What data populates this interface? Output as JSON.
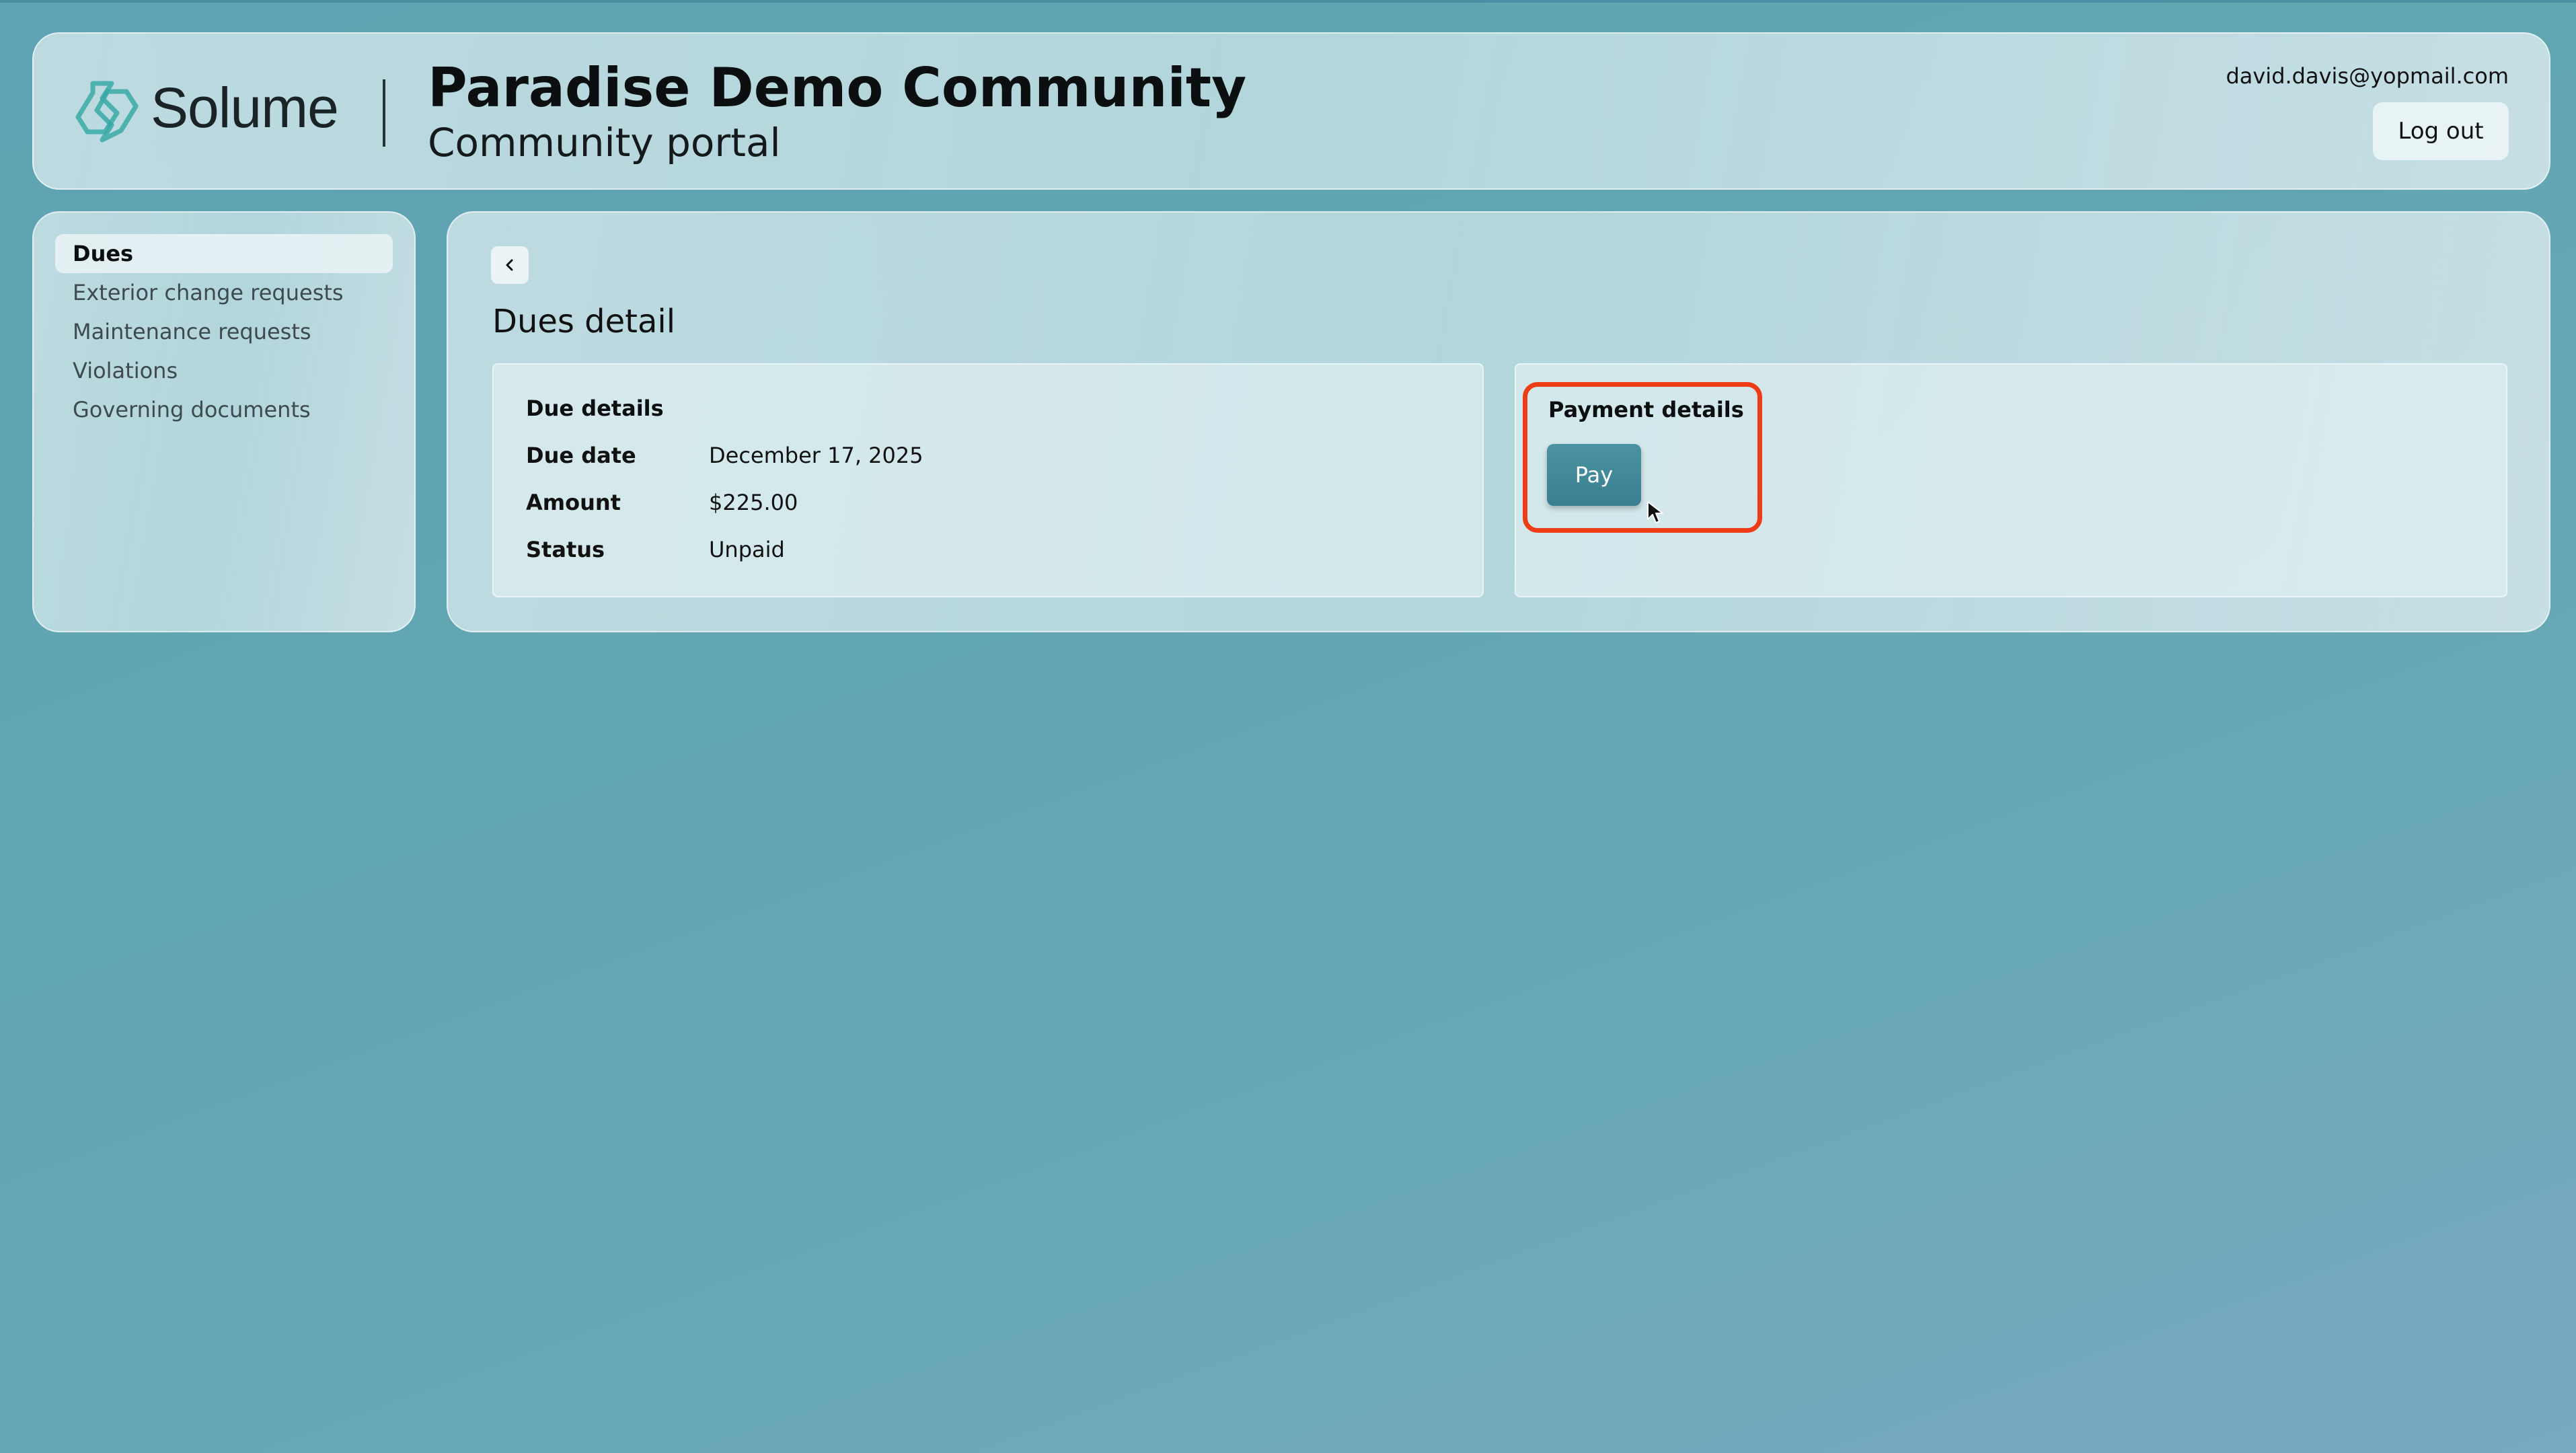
{
  "header": {
    "brand": "Solume",
    "community_name": "Paradise Demo Community",
    "portal_name": "Community portal",
    "user_email": "david.davis@yopmail.com",
    "logout_label": "Log out"
  },
  "sidebar": {
    "items": [
      {
        "label": "Dues",
        "active": true
      },
      {
        "label": "Exterior change requests",
        "active": false
      },
      {
        "label": "Maintenance requests",
        "active": false
      },
      {
        "label": "Violations",
        "active": false
      },
      {
        "label": "Governing documents",
        "active": false
      }
    ]
  },
  "main": {
    "title": "Dues detail",
    "due_details": {
      "title": "Due details",
      "rows": [
        {
          "label": "Due date",
          "value": "December 17, 2025"
        },
        {
          "label": "Amount",
          "value": "$225.00"
        },
        {
          "label": "Status",
          "value": "Unpaid"
        }
      ]
    },
    "payment_details": {
      "title": "Payment details",
      "pay_label": "Pay"
    }
  },
  "colors": {
    "accent": "#3f8797",
    "highlight": "#ee3d16",
    "logo": "#3aa9a6"
  },
  "icons": [
    "solume-logo-icon",
    "chevron-left-icon",
    "mouse-cursor-icon"
  ]
}
